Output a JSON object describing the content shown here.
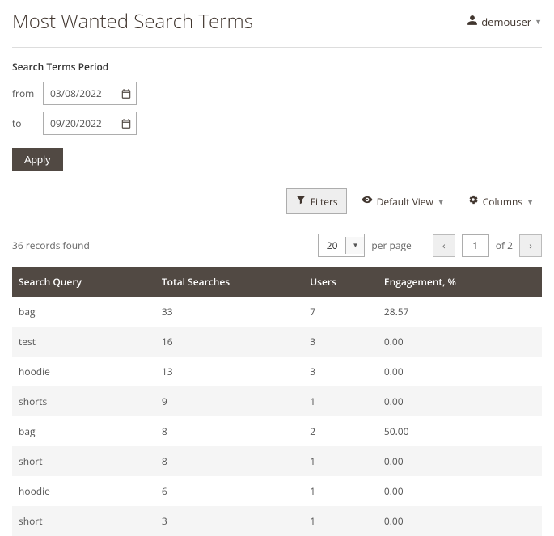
{
  "header": {
    "title": "Most Wanted Search Terms",
    "user": "demouser"
  },
  "period": {
    "label": "Search Terms Period",
    "from_label": "from",
    "to_label": "to",
    "from_value": "03/08/2022",
    "to_value": "09/20/2022",
    "apply_label": "Apply"
  },
  "toolbar": {
    "filters_label": "Filters",
    "default_view_label": "Default View",
    "columns_label": "Columns",
    "records_found": "36 records found",
    "per_page_value": "20",
    "per_page_label": "per page",
    "current_page": "1",
    "total_pages_label": "of 2"
  },
  "table": {
    "headers": {
      "query": "Search Query",
      "searches": "Total Searches",
      "users": "Users",
      "engagement": "Engagement, %"
    },
    "rows": [
      {
        "query": "bag",
        "searches": "33",
        "users": "7",
        "engagement": "28.57"
      },
      {
        "query": "test",
        "searches": "16",
        "users": "3",
        "engagement": "0.00"
      },
      {
        "query": "hoodie",
        "searches": "13",
        "users": "3",
        "engagement": "0.00"
      },
      {
        "query": "shorts",
        "searches": "9",
        "users": "1",
        "engagement": "0.00"
      },
      {
        "query": "bag",
        "searches": "8",
        "users": "2",
        "engagement": "50.00"
      },
      {
        "query": "short",
        "searches": "8",
        "users": "1",
        "engagement": "0.00"
      },
      {
        "query": "hoodie",
        "searches": "6",
        "users": "1",
        "engagement": "0.00"
      },
      {
        "query": "short",
        "searches": "3",
        "users": "1",
        "engagement": "0.00"
      }
    ]
  }
}
